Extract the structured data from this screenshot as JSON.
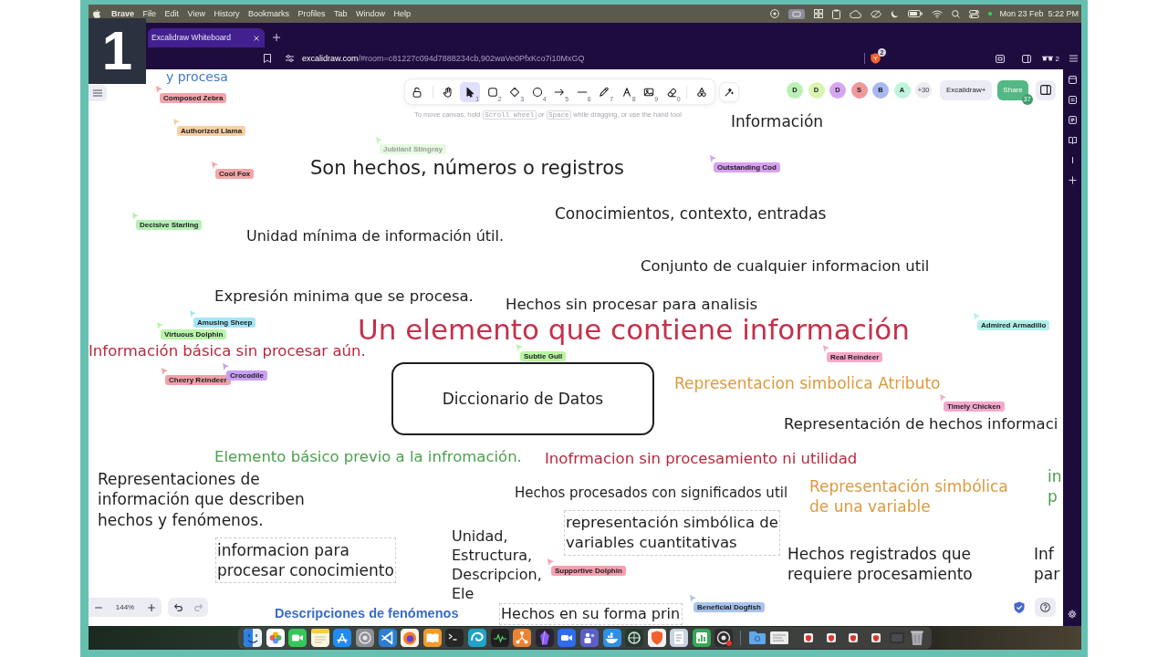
{
  "overlay_badge": "1",
  "menu_bar": {
    "app_name": "Brave",
    "menus": [
      "File",
      "Edit",
      "View",
      "History",
      "Bookmarks",
      "Profiles",
      "Tab",
      "Window",
      "Help"
    ],
    "date": "Mon 23 Feb",
    "time": "5:22 PM"
  },
  "browser": {
    "tabs": [
      {
        "title": "Excalidraw Whiteboard",
        "selected": true
      }
    ],
    "address": {
      "host": "excalidraw.com",
      "path": "/#room=c81227c094d7888234cb,902waVe0PfxKco7i10MxGQ"
    },
    "shields_count": "2",
    "profile_count": "2"
  },
  "toolbar": {
    "tools": [
      {
        "kind": "lock",
        "selected": false
      },
      {
        "kind": "hand",
        "selected": false
      },
      {
        "kind": "selection",
        "key": "1",
        "selected": true
      },
      {
        "kind": "rectangle",
        "key": "2",
        "selected": false
      },
      {
        "kind": "diamond",
        "key": "3",
        "selected": false
      },
      {
        "kind": "ellipse",
        "key": "4",
        "selected": false
      },
      {
        "kind": "arrow",
        "key": "5",
        "selected": false
      },
      {
        "kind": "line",
        "key": "6",
        "selected": false
      },
      {
        "kind": "pencil",
        "key": "7",
        "selected": false
      },
      {
        "kind": "text",
        "key": "8",
        "selected": false
      },
      {
        "kind": "image",
        "key": "9",
        "selected": false
      },
      {
        "kind": "eraser",
        "key": "0",
        "selected": false
      },
      {
        "kind": "more",
        "selected": false
      }
    ],
    "hint": [
      {
        "kind": "text",
        "text": "To move canvas, hold"
      },
      {
        "kind": "key",
        "text": "Scroll wheel"
      },
      {
        "kind": "text",
        "text": "or"
      },
      {
        "kind": "key",
        "text": "Space"
      },
      {
        "kind": "text",
        "text": "while dragging, or use the hand tool"
      }
    ]
  },
  "collaborators": {
    "avatars": [
      {
        "initial": "D",
        "color": "#b9f0b4"
      },
      {
        "initial": "D",
        "color": "#d9f5b0"
      },
      {
        "initial": "D",
        "color": "#d6a6f2"
      },
      {
        "initial": "S",
        "color": "#f0999d"
      },
      {
        "initial": "B",
        "color": "#a9b8f2"
      },
      {
        "initial": "A",
        "color": "#c0f5dc"
      }
    ],
    "more": "+30"
  },
  "plus_button": "Excalidraw+",
  "share": {
    "label": "Share",
    "count": "37"
  },
  "canvas": {
    "elements": [
      {
        "kind": "text",
        "text": "y procesa",
        "color": "#3f78c9",
        "remote_selected": false
      },
      {
        "kind": "text",
        "text": "Información",
        "color": "#1e1e1e",
        "remote_selected": false
      },
      {
        "kind": "text",
        "text": "Son hechos, números o registros",
        "color": "#1e1e1e",
        "remote_selected": false
      },
      {
        "kind": "text",
        "text": "Conocimientos, contexto, entradas",
        "color": "#1e1e1e",
        "remote_selected": false
      },
      {
        "kind": "text",
        "text": "Unidad mínima de información útil.",
        "color": "#1e1e1e",
        "remote_selected": false
      },
      {
        "kind": "text",
        "text": "Conjunto de cualquier informacion util",
        "color": "#1e1e1e",
        "remote_selected": false
      },
      {
        "kind": "text",
        "text": "Expresión minima que se procesa.",
        "color": "#1e1e1e",
        "remote_selected": false
      },
      {
        "kind": "text",
        "text": "Hechos sin procesar para analisis",
        "color": "#1e1e1e",
        "remote_selected": false
      },
      {
        "kind": "text",
        "text": "Un elemento que contiene información",
        "color": "#c4314b",
        "remote_selected": false
      },
      {
        "kind": "text",
        "text": "Información básica sin procesar aún.",
        "color": "#b8283e",
        "remote_selected": false
      },
      {
        "kind": "box",
        "text": "Diccionario de Datos",
        "color": "#1e1e1e",
        "remote_selected": false
      },
      {
        "kind": "text",
        "text": "Representacion simbolica Atributo",
        "color": "#dd9a3c",
        "remote_selected": false
      },
      {
        "kind": "text",
        "text": "Representación de hechos informaci",
        "color": "#1e1e1e",
        "remote_selected": false
      },
      {
        "kind": "text",
        "text": "Elemento básico previo a la infromación.",
        "color": "#4ba04f",
        "remote_selected": false
      },
      {
        "kind": "text",
        "text": "Inofrmacion sin procesamiento ni utilidad",
        "color": "#b8283e",
        "remote_selected": false
      },
      {
        "kind": "text",
        "text": "Representaciones de\ninformación que describen\nhechos y fenómenos.",
        "color": "#1e1e1e",
        "remote_selected": false
      },
      {
        "kind": "text",
        "text": "Hechos procesados con significados util",
        "color": "#1e1e1e",
        "remote_selected": false
      },
      {
        "kind": "text",
        "text": "Representación simbólica\nde una variable",
        "color": "#dd9a3c",
        "remote_selected": false
      },
      {
        "kind": "text",
        "text": "in\np",
        "color": "#4ba04f",
        "remote_selected": false
      },
      {
        "kind": "text",
        "text": "representación simbólica de\nvariables cuantitativas",
        "color": "#1e1e1e",
        "remote_selected": true
      },
      {
        "kind": "text",
        "text": "informacion para\nprocesar conocimiento",
        "color": "#1e1e1e",
        "remote_selected": true
      },
      {
        "kind": "text",
        "text": "Unidad,\nEstructura,\nDescripcion,\nEle",
        "color": "#1e1e1e",
        "remote_selected": false
      },
      {
        "kind": "text",
        "text": "Hechos registrados que\nrequiere procesamiento",
        "color": "#1e1e1e",
        "remote_selected": false
      },
      {
        "kind": "text",
        "text": "Inf\npar",
        "color": "#1e1e1e",
        "remote_selected": false
      },
      {
        "kind": "heading",
        "text": "Descripciones de fenómenos",
        "color": "#3a6cc6",
        "remote_selected": false
      },
      {
        "kind": "text",
        "text": "Hechos en su forma prin",
        "color": "#1e1e1e",
        "remote_selected": true
      }
    ],
    "cursors": [
      {
        "name": "Composed Zebra",
        "color": "#f2a3ab",
        "idle": false
      },
      {
        "name": "Authorized Llama",
        "color": "#f7cfa1",
        "idle": false
      },
      {
        "name": "Jubilant Stingray",
        "color": "#c9f2bd",
        "idle": true
      },
      {
        "name": "Cool Fox",
        "color": "#f3a6a6",
        "idle": false
      },
      {
        "name": "Outstanding Cod",
        "color": "#d8a0f0",
        "idle": false
      },
      {
        "name": "Decisive Starling",
        "color": "#b5f0b5",
        "idle": false
      },
      {
        "name": "Amusing Sheep",
        "color": "#a5e6f5",
        "idle": false
      },
      {
        "name": "Virtuous Dolphin",
        "color": "#b8f5a8",
        "idle": false
      },
      {
        "name": "Admired Armadillo",
        "color": "#b0f0e8",
        "idle": false
      },
      {
        "name": "Subtle Gull",
        "color": "#b8f5a0",
        "idle": false
      },
      {
        "name": "Real Reindeer",
        "color": "#f5a8c8",
        "idle": false
      },
      {
        "name": "Cheery Reindeer",
        "color": "#f0a0a8",
        "idle": false
      },
      {
        "name": "Crocodile",
        "color": "#c9a0f5",
        "idle": false
      },
      {
        "name": "Timely Chicken",
        "color": "#f5a8cc",
        "idle": false
      },
      {
        "name": "Supportive Dolphin",
        "color": "#f5a0b0",
        "idle": false
      },
      {
        "name": "Beneficial Dogfish",
        "color": "#a8c4ec",
        "idle": false
      }
    ]
  },
  "zoom_text": "144%",
  "history": {
    "undo_disabled": false,
    "redo_disabled": true
  }
}
